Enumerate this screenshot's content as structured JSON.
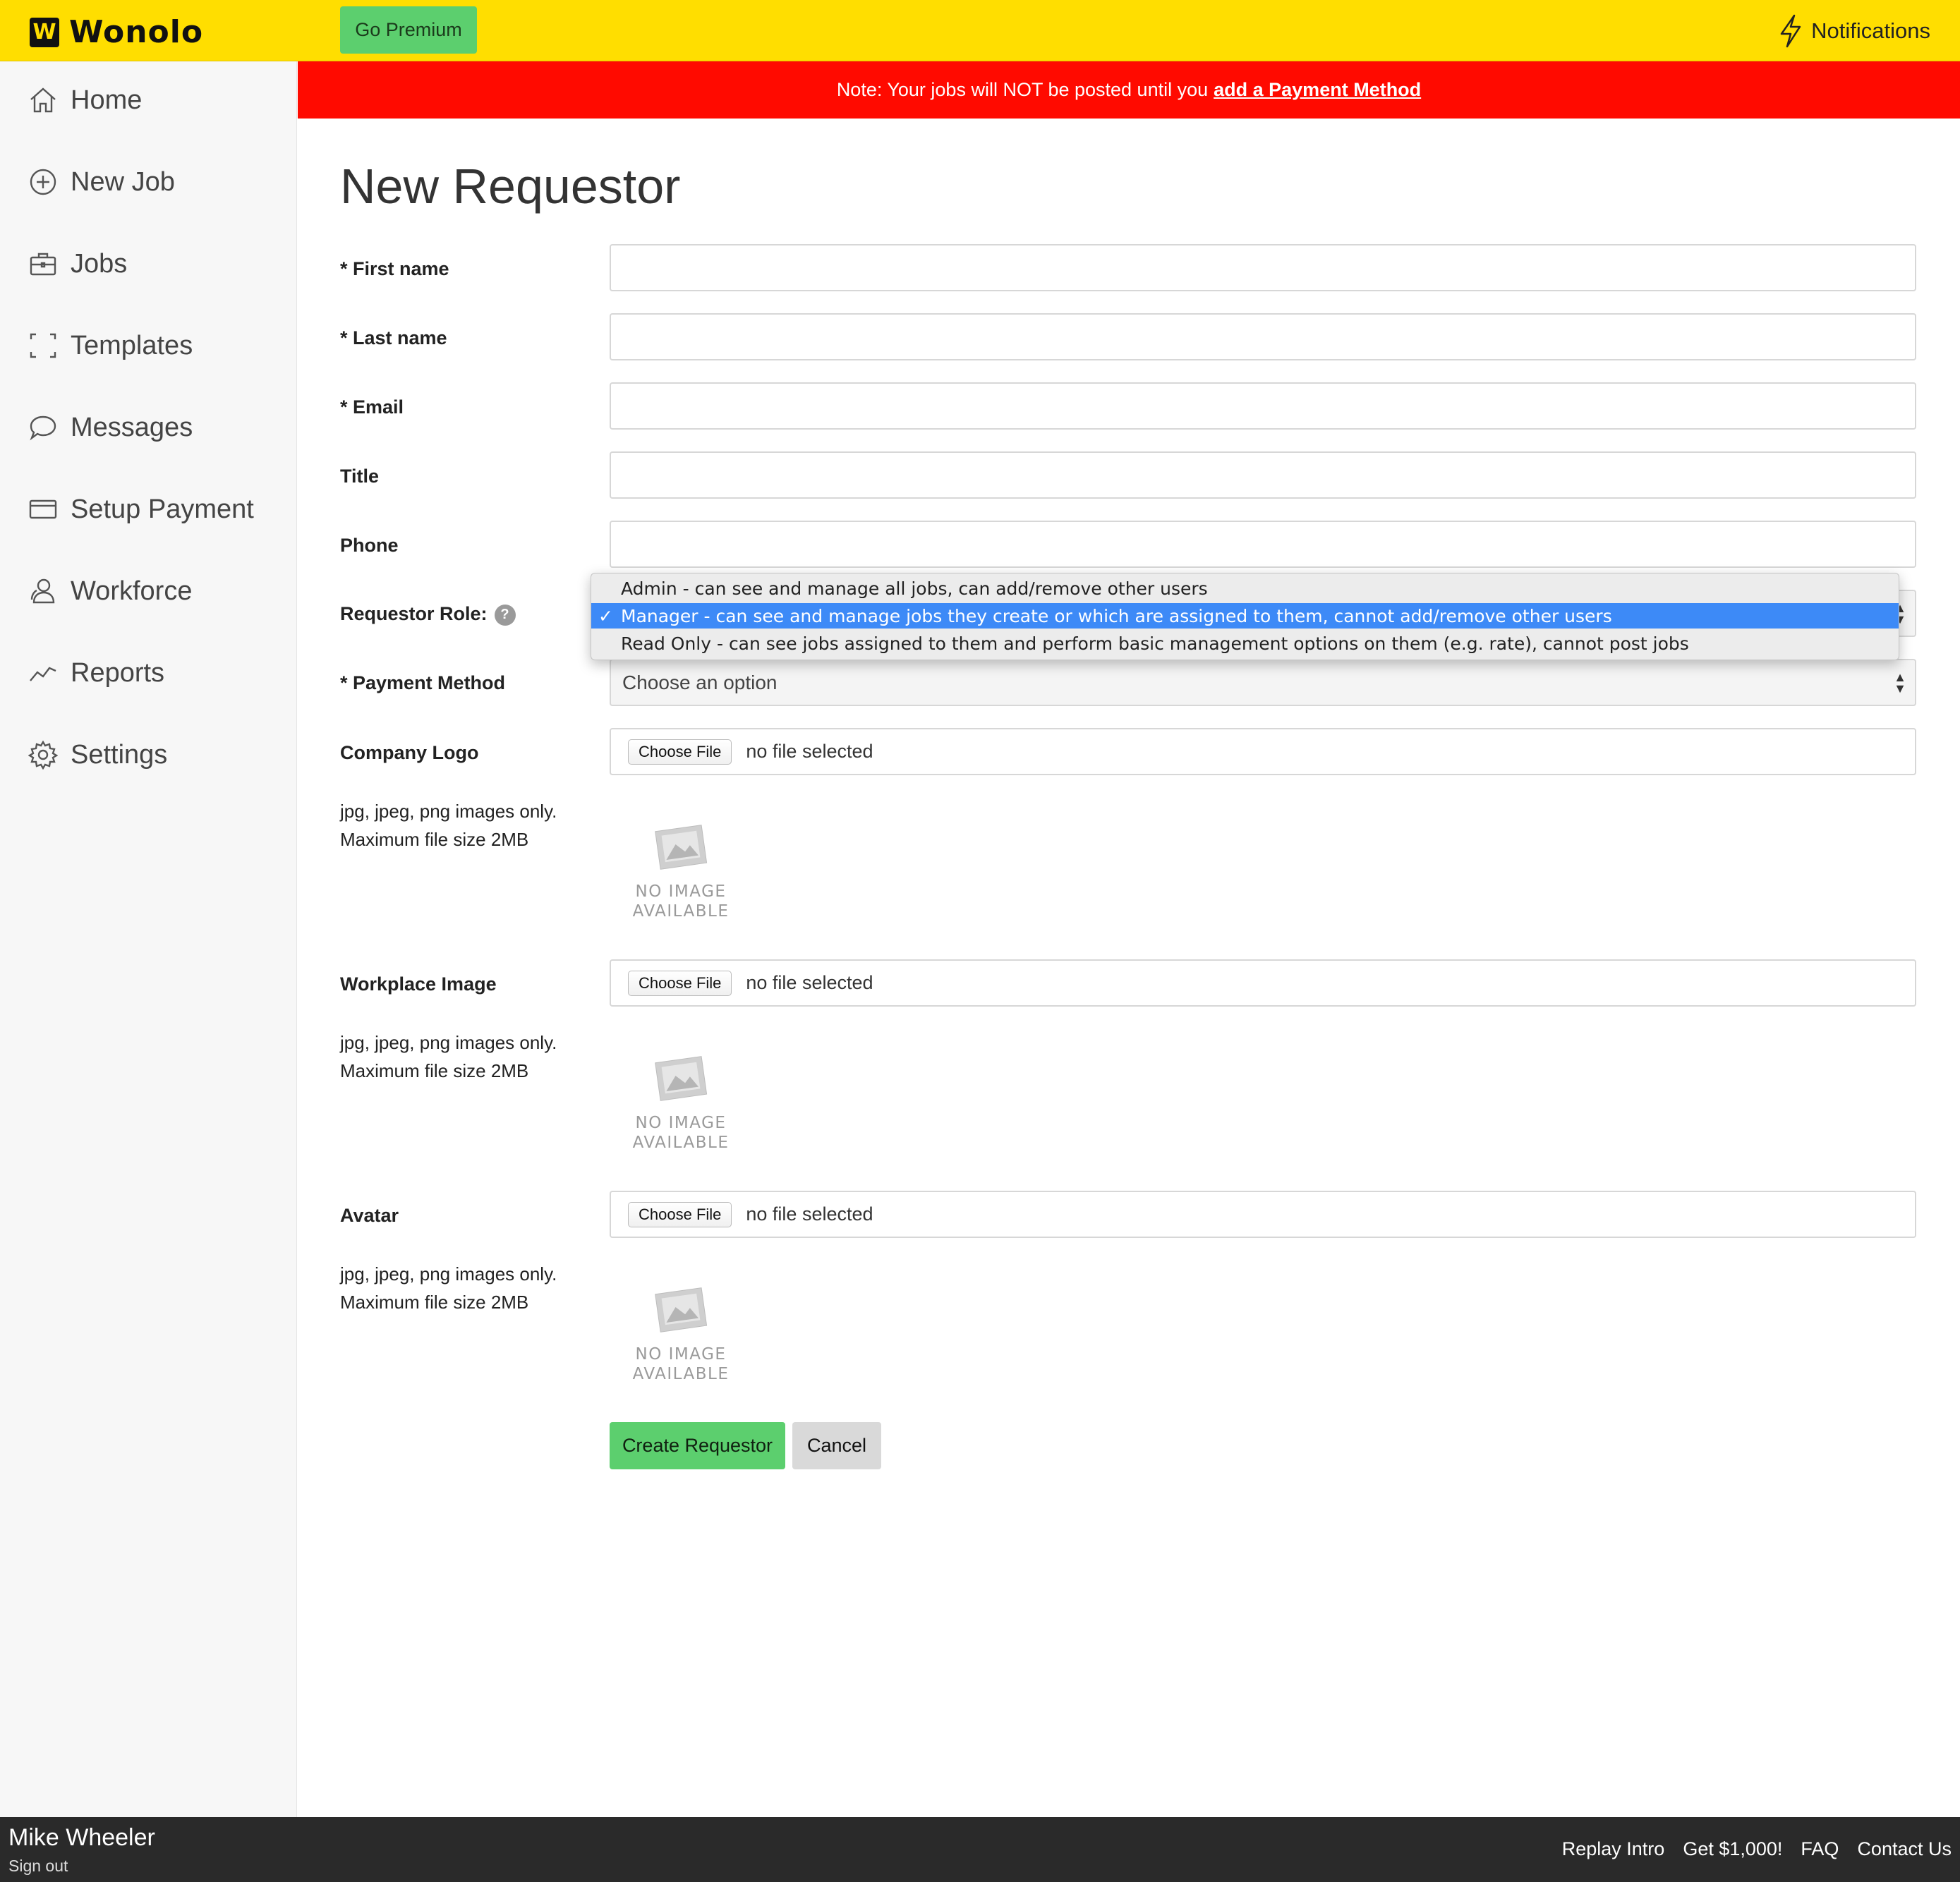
{
  "header": {
    "brand": "Wonolo",
    "brand_mark": "W",
    "premium_label": "Go Premium",
    "notifications_label": "Notifications"
  },
  "sidebar": {
    "items": [
      {
        "label": "Home",
        "icon": "home-icon"
      },
      {
        "label": "New Job",
        "icon": "plus-circle-icon"
      },
      {
        "label": "Jobs",
        "icon": "briefcase-icon"
      },
      {
        "label": "Templates",
        "icon": "template-icon"
      },
      {
        "label": "Messages",
        "icon": "chat-icon"
      },
      {
        "label": "Setup Payment",
        "icon": "credit-card-icon"
      },
      {
        "label": "Workforce",
        "icon": "people-icon"
      },
      {
        "label": "Reports",
        "icon": "chart-line-icon"
      },
      {
        "label": "Settings",
        "icon": "gear-icon"
      }
    ]
  },
  "banner": {
    "text": "Note: Your jobs will NOT be posted until you",
    "link": "add a Payment Method",
    "color": "#ff0a00"
  },
  "form": {
    "title": "New Requestor",
    "first_name_label": "* First name",
    "last_name_label": "* Last name",
    "email_label": "* Email",
    "title_label": "Title",
    "phone_label": "Phone",
    "role_label": "Requestor Role:",
    "role_help": "?",
    "role_options": [
      "Admin - can see and manage all jobs, can add/remove other users",
      "Manager - can see and manage jobs they create or which are assigned to them, cannot add/remove other users",
      "Read Only - can see jobs assigned to them and perform basic management options on them (e.g. rate), cannot post jobs"
    ],
    "role_selected_index": 1,
    "payment_label": "* Payment Method",
    "payment_value": "Choose an option",
    "uploads": [
      {
        "label": "Company Logo",
        "button": "Choose File",
        "status": "no file selected",
        "hint1": "jpg, jpeg, png images only.",
        "hint2": "Maximum file size 2MB",
        "placeholder1": "NO IMAGE",
        "placeholder2": "AVAILABLE"
      },
      {
        "label": "Workplace Image",
        "button": "Choose File",
        "status": "no file selected",
        "hint1": "jpg, jpeg, png images only.",
        "hint2": "Maximum file size 2MB",
        "placeholder1": "NO IMAGE",
        "placeholder2": "AVAILABLE"
      },
      {
        "label": "Avatar",
        "button": "Choose File",
        "status": "no file selected",
        "hint1": "jpg, jpeg, png images only.",
        "hint2": "Maximum file size 2MB",
        "placeholder1": "NO IMAGE",
        "placeholder2": "AVAILABLE"
      }
    ],
    "create_label": "Create Requestor",
    "cancel_label": "Cancel"
  },
  "footer": {
    "user_name": "Mike Wheeler",
    "sign_out": "Sign out",
    "links": [
      "Replay Intro",
      "Get $1,000!",
      "FAQ",
      "Contact Us"
    ]
  },
  "colors": {
    "topbar": "#ffde00",
    "accent_green": "#5ccf6e",
    "selection_blue": "#3d8af7",
    "footer": "#2a2a2a"
  }
}
